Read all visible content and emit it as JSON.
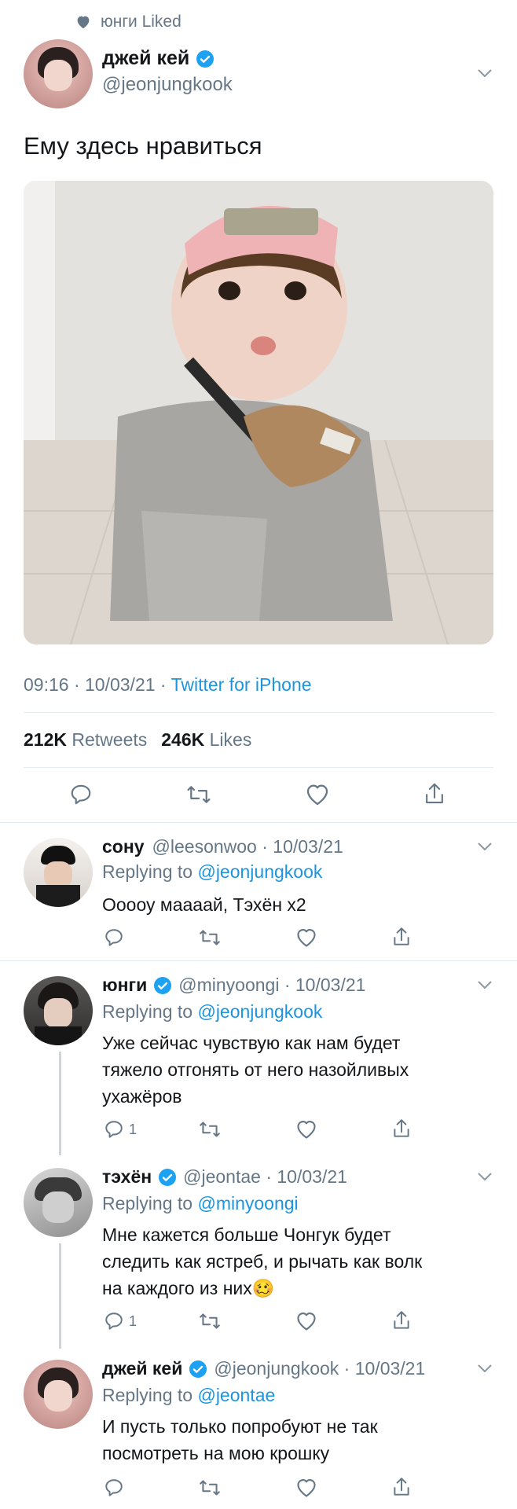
{
  "social_context": {
    "text": "юнги Liked",
    "icon": "heart-icon"
  },
  "main_tweet": {
    "name": "джей кей",
    "handle": "@jeonjungkook",
    "text": "Ему здесь нравиться",
    "time": "09:16 · 10/03/21 · ",
    "source": "Twitter for iPhone",
    "retweets_count": "212K",
    "retweets_label": "Retweets",
    "likes_count": "246K",
    "likes_label": "Likes"
  },
  "replies": [
    {
      "name": "сону",
      "verified": false,
      "handle_time": "@leesonwoo · 10/03/21",
      "replying_prefix": "Replying to",
      "replying_to": "@jeonjungkook",
      "text": "Ооооу маааай, Тэхён х2",
      "reply_count": ""
    },
    {
      "name": "юнги",
      "verified": true,
      "handle_time": "@minyoongi · 10/03/21",
      "replying_prefix": "Replying to",
      "replying_to": "@jeonjungkook",
      "text_lines": [
        "Уже сейчас чувствую как нам будет",
        "тяжело отгонять от него назойливых",
        "ухажёров"
      ],
      "reply_count": "1"
    },
    {
      "name": "тэхён",
      "verified": true,
      "handle_time": "@jeontae · 10/03/21",
      "replying_prefix": "Replying to",
      "replying_to": "@minyoongi",
      "text_lines": [
        "Мне кажется больше Чонгук будет",
        "следить как ястреб, и рычать как волк",
        "на каждого из них🥴"
      ],
      "reply_count": "1"
    },
    {
      "name": "джей кей",
      "verified": true,
      "handle_time": "@jeonjungkook · 10/03/21",
      "replying_prefix": "Replying to",
      "replying_to": "@jeontae",
      "text_lines": [
        "И пусть только попробуют не так",
        "посмотреть на мою крошку"
      ],
      "reply_count": ""
    }
  ],
  "colors": {
    "link": "#1b95e0",
    "muted": "#657786",
    "divider": "#e6ecf0",
    "verified": "#1da1f2"
  }
}
